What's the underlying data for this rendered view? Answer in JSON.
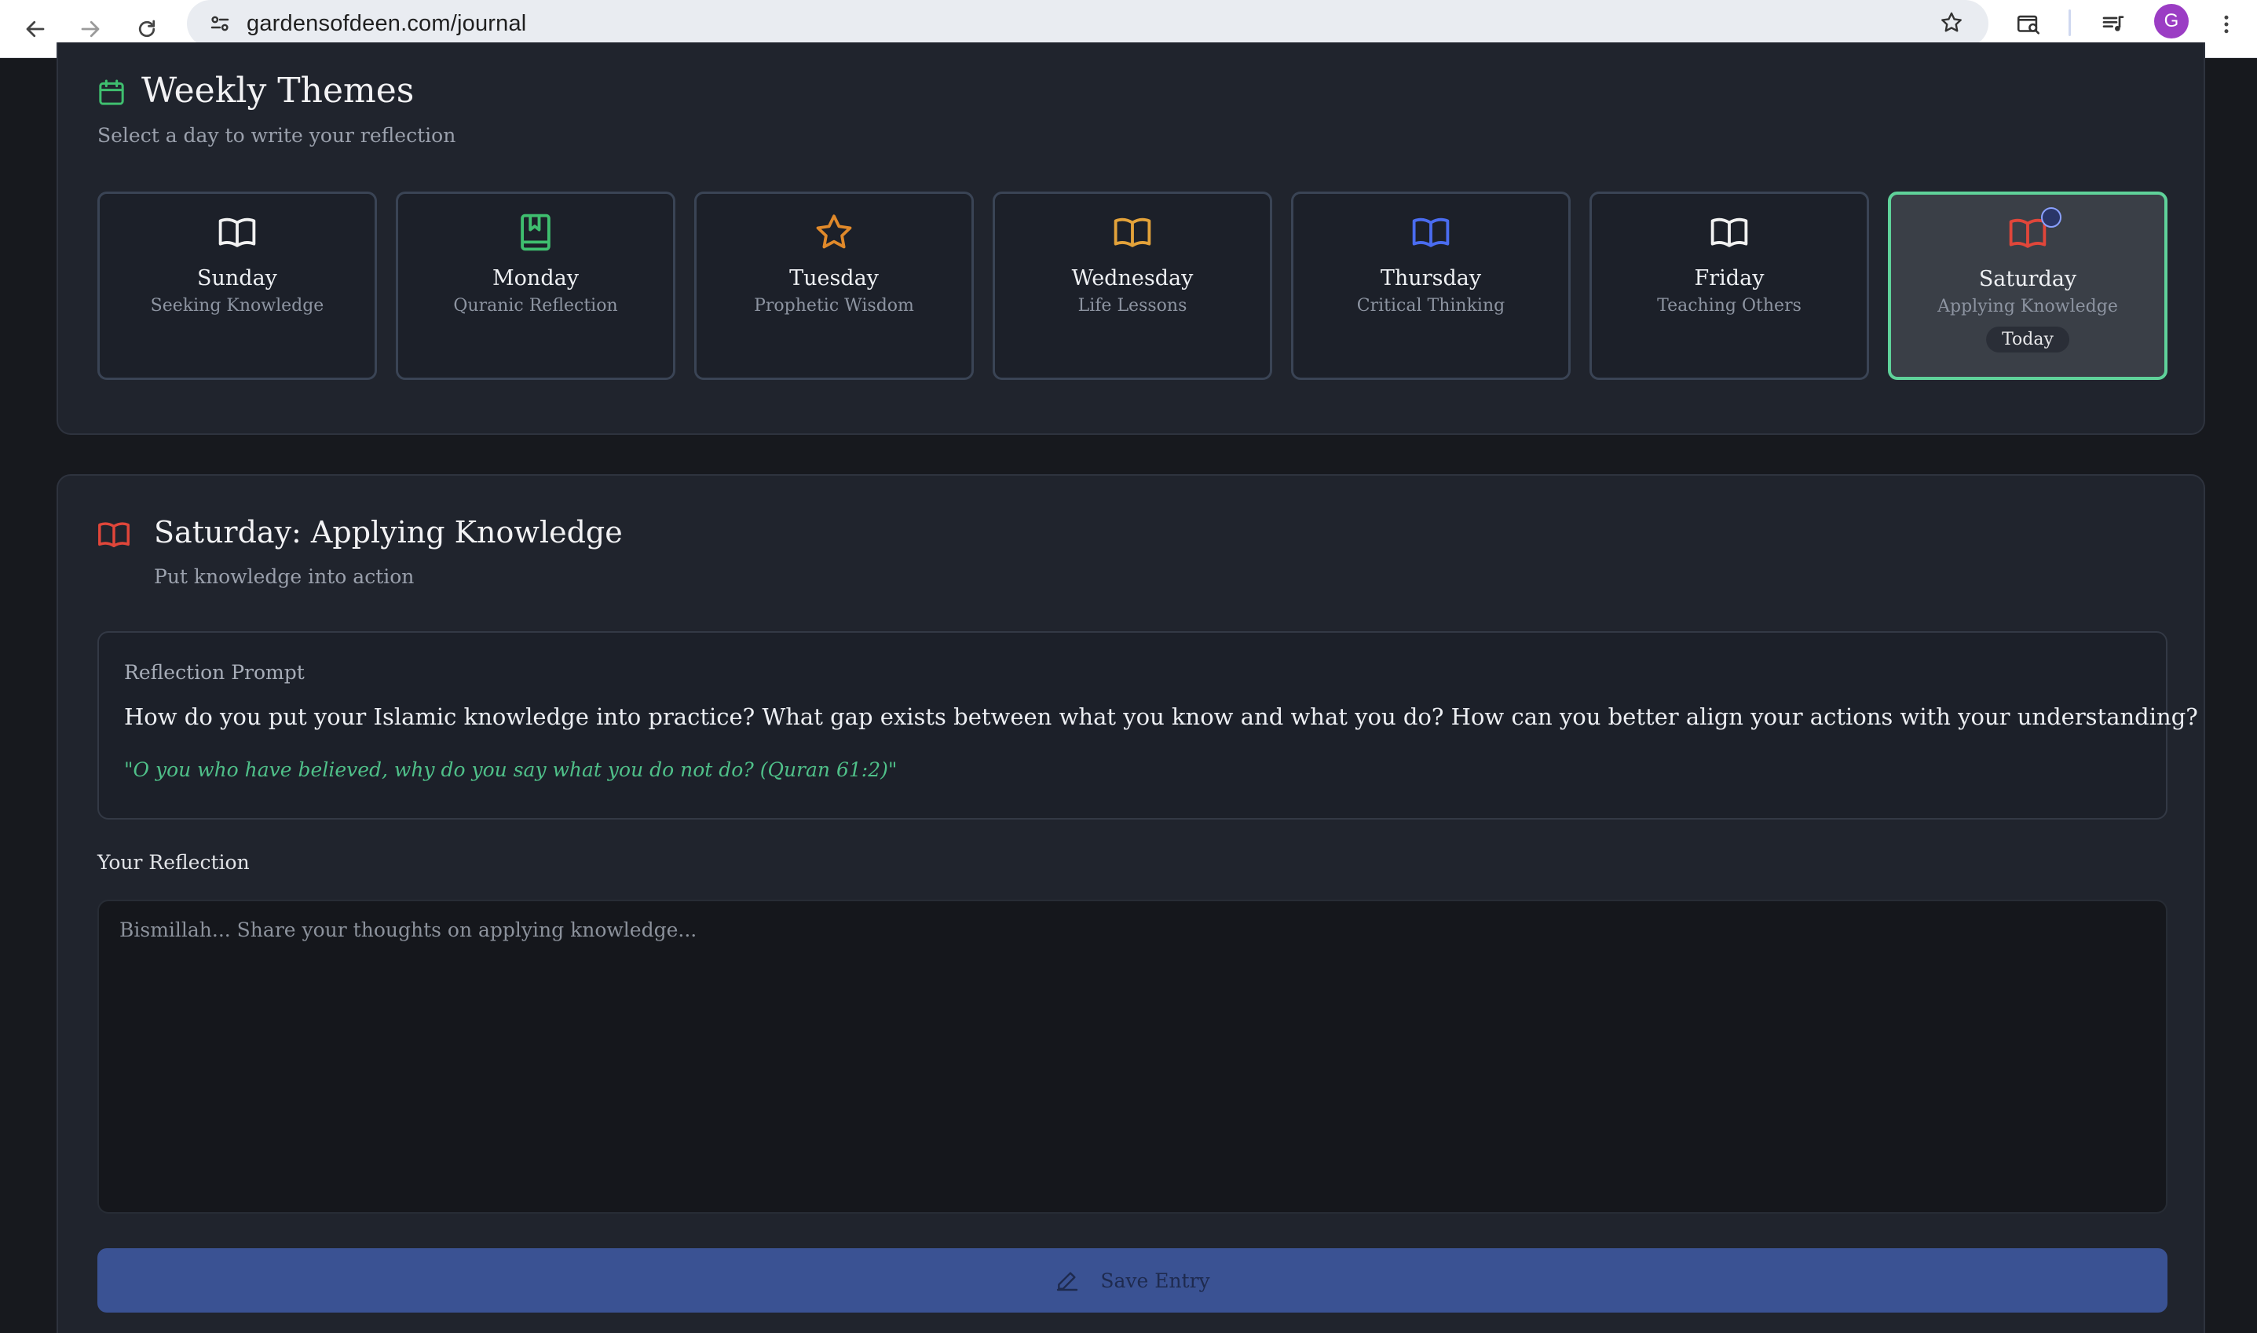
{
  "browser": {
    "url": "gardensofdeen.com/journal",
    "avatar_letter": "G",
    "icons": [
      "back-arrow-icon",
      "forward-arrow-icon",
      "reload-icon",
      "site-settings-icon",
      "bookmark-star-icon",
      "tab-search-icon",
      "media-playlist-icon",
      "more-vert-icon"
    ]
  },
  "weekly_themes": {
    "title": "Weekly Themes",
    "subtitle": "Select a day to write your reflection",
    "icon": "calendar-icon",
    "days": [
      {
        "name": "Sunday",
        "theme": "Seeking Knowledge",
        "icon": "open-book-icon",
        "color": "#f1f1f1"
      },
      {
        "name": "Monday",
        "theme": "Quranic Reflection",
        "icon": "bookmark-book-icon",
        "color": "#3fbf6f"
      },
      {
        "name": "Tuesday",
        "theme": "Prophetic Wisdom",
        "icon": "star-icon",
        "color": "#e0892a"
      },
      {
        "name": "Wednesday",
        "theme": "Life Lessons",
        "icon": "open-book-icon",
        "color": "#e3a23a"
      },
      {
        "name": "Thursday",
        "theme": "Critical Thinking",
        "icon": "open-book-icon",
        "color": "#4a6cf0"
      },
      {
        "name": "Friday",
        "theme": "Teaching Others",
        "icon": "open-book-icon",
        "color": "#f1f1f1"
      },
      {
        "name": "Saturday",
        "theme": "Applying Knowledge",
        "icon": "open-book-icon",
        "color": "#e0463a",
        "today_badge": "Today",
        "selected": true
      }
    ]
  },
  "entry": {
    "title": "Saturday: Applying Knowledge",
    "subtitle": "Put knowledge into action",
    "icon": "open-book-icon",
    "icon_color": "#e0463a",
    "prompt_label": "Reflection Prompt",
    "prompt_text": "How do you put your Islamic knowledge into practice? What gap exists between what you know and what you do? How can you better align your actions with your understanding?",
    "verse": "\"O you who have believed, why do you say what you do not do? (Quran 61:2)\"",
    "reflection_label": "Your Reflection",
    "reflection_placeholder": "Bismillah... Share your thoughts on applying knowledge...",
    "reflection_value": "",
    "save_label": "Save Entry"
  },
  "colors": {
    "accent_green": "#5fd29a",
    "save_button": "#3a5293",
    "background": "#17191e",
    "card": "#20242d"
  }
}
